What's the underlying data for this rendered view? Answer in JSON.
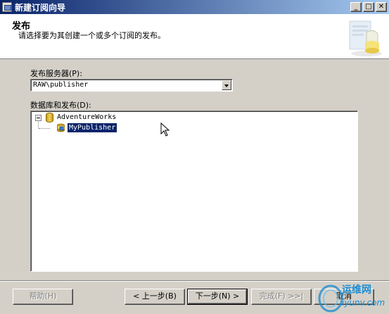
{
  "window": {
    "title": "新建订阅向导"
  },
  "header": {
    "title": "发布",
    "description": "请选择要为其创建一个或多个订阅的发布。"
  },
  "publisher": {
    "label": "发布服务器(P):",
    "value": "RAW\\publisher"
  },
  "databases": {
    "label": "数据库和发布(D):",
    "tree": {
      "root": "AdventureWorks",
      "children": [
        "MyPublisher"
      ]
    }
  },
  "buttons": {
    "help": "帮助(H)",
    "back": "< 上一步(B)",
    "next": "下一步(N) >",
    "finish": "完成(F) >>|",
    "cancel": "取消"
  },
  "watermark": {
    "line1": "运维网",
    "line2": "iyunv.com"
  },
  "colors": {
    "title_bar_start": "#0a246a",
    "title_bar_end": "#a6caf0",
    "selection": "#0a246a",
    "dialog_bg": "#d4d0c8",
    "watermark": "#1e8cd0"
  },
  "icons": {
    "app": "wizard-icon",
    "minimize": "minimize-icon",
    "maximize": "maximize-icon",
    "close": "close-icon",
    "database": "database-icon",
    "publication": "publication-icon",
    "header_graphic": "publication-graphic-icon",
    "cursor": "mouse-cursor-icon"
  }
}
